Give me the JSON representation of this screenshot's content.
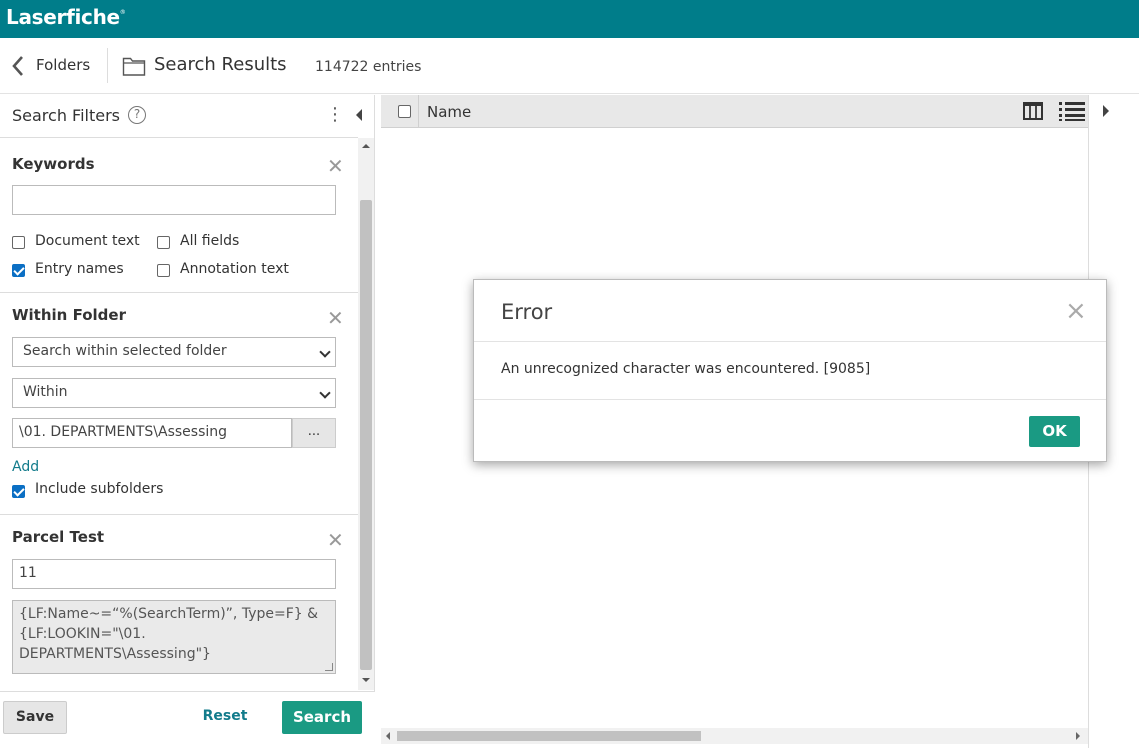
{
  "app": {
    "brand": "Laserfiche",
    "brand_mark": "®"
  },
  "nav": {
    "back_label": "Folders",
    "title": "Search Results",
    "entry_count": "114722 entries"
  },
  "filters": {
    "title": "Search Filters",
    "help_glyph": "?",
    "kebab_glyph": "⋮",
    "keywords": {
      "title": "Keywords",
      "value": "",
      "options": [
        {
          "label": "Document text",
          "checked": false
        },
        {
          "label": "All fields",
          "checked": false
        },
        {
          "label": "Entry names",
          "checked": true
        },
        {
          "label": "Annotation text",
          "checked": false
        }
      ]
    },
    "within_folder": {
      "title": "Within Folder",
      "scope_select": "Search within selected folder",
      "mode_select": "Within",
      "path": "\\01. DEPARTMENTS\\Assessing",
      "browse_label": "...",
      "add_label": "Add",
      "include_subfolders_label": "Include subfolders",
      "include_subfolders_checked": true
    },
    "parcel_test": {
      "title": "Parcel Test",
      "value": "11",
      "query": "{LF:Name~=“%(SearchTerm)”, Type=F} & {LF:LOOKIN=\"\\01. DEPARTMENTS\\Assessing\"}"
    },
    "close_glyph": "✕",
    "buttons": {
      "save": "Save",
      "reset": "Reset",
      "search": "Search"
    }
  },
  "results": {
    "column_name": "Name",
    "column_picker_icon": "columns-icon",
    "view_icon": "list-view-icon"
  },
  "dialog": {
    "title": "Error",
    "close_glyph": "×",
    "message": "An unrecognized character was encountered. [9085]",
    "ok_label": "OK"
  },
  "colors": {
    "brand_bar": "#007d8a",
    "primary_button": "#1a9a83",
    "link": "#127b8b",
    "checkbox": "#0b6fc4"
  }
}
